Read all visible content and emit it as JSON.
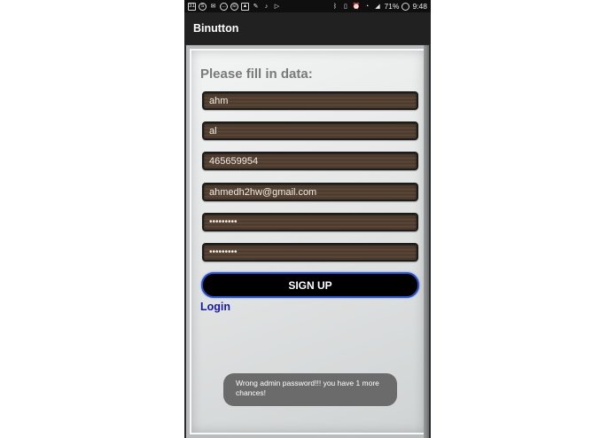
{
  "status_bar": {
    "left_icons": [
      "calendar-31-icon",
      "skype-icon",
      "gmail-icon",
      "chat-icon",
      "whatsapp-icon",
      "image-icon",
      "photo-edit-icon",
      "music-icon",
      "play-store-icon"
    ],
    "calendar_day": "31",
    "battery_percent": "71%",
    "time": "9:48"
  },
  "app_bar": {
    "title": "Binutton"
  },
  "form": {
    "heading": "Please fill in data:",
    "fields": [
      {
        "name": "first-name",
        "value": "ahm"
      },
      {
        "name": "last-name",
        "value": "al"
      },
      {
        "name": "phone",
        "value": "465659954"
      },
      {
        "name": "email",
        "value": "ahmedh2hw@gmail.com"
      },
      {
        "name": "password",
        "value": "•••••••••"
      },
      {
        "name": "confirm-password",
        "value": "•••••••••"
      }
    ],
    "signup_label": "SIGN UP",
    "login_label": "Login"
  },
  "toast": {
    "message": "Wrong admin password!!! you have 1 more chances!"
  },
  "colors": {
    "app_bar": "#212121",
    "status_bar": "#0f0f0f",
    "signup_bg": "#000000",
    "signup_border": "#2a52c9",
    "login_link": "#1a1aa6",
    "heading": "#7a7a7a",
    "toast_bg": "#6b6b6b"
  }
}
